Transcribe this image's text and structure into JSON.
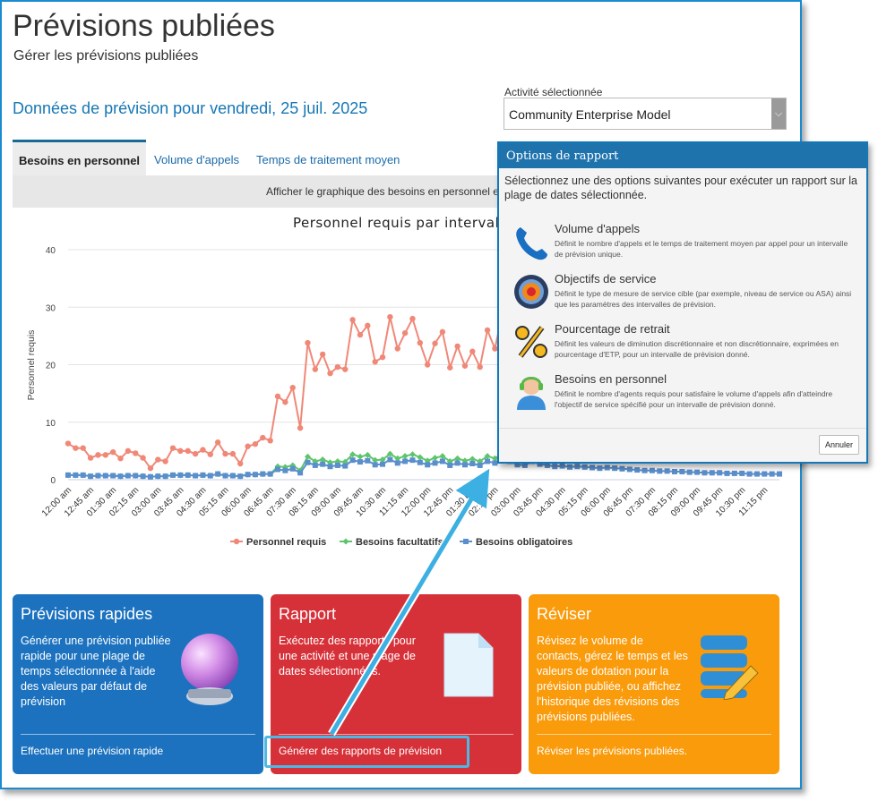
{
  "page": {
    "title": "Prévisions publiées",
    "subtitle": "Gérer les prévisions publiées",
    "forecast_heading": "Données de prévision pour vendredi, 25 juil. 2025"
  },
  "activity": {
    "label": "Activité sélectionnée",
    "value": "Community Enterprise Model"
  },
  "tabs": [
    {
      "label": "Besoins en personnel",
      "active": true
    },
    {
      "label": "Volume d'appels",
      "active": false
    },
    {
      "label": "Temps de traitement moyen",
      "active": false
    }
  ],
  "chart_hint": "Afficher le graphique des besoins en personnel en",
  "chart_data": {
    "type": "line",
    "title": "Personnel requis par intervall",
    "ylabel": "Personnel requis",
    "xlabel": "",
    "ylim": [
      0,
      40
    ],
    "yticks": [
      0,
      10,
      20,
      30,
      40
    ],
    "grid": true,
    "legend_position": "bottom-center",
    "xtick_labels": [
      "12:00 am",
      "12:45 am",
      "01:30 am",
      "02:15 am",
      "03:00 am",
      "03:45 am",
      "04:30 am",
      "05:15 am",
      "06:00 am",
      "06:45 am",
      "07:30 am",
      "08:15 am",
      "09:00 am",
      "09:45 am",
      "10:30 am",
      "11:15 am",
      "12:00 pm",
      "12:45 pm",
      "01:30 pm",
      "02:15 pm",
      "03:00 pm",
      "03:45 pm",
      "04:30 pm",
      "05:15 pm",
      "06:00 pm",
      "06:45 pm",
      "07:30 pm",
      "08:15 pm",
      "09:00 pm",
      "09:45 pm",
      "10:30 pm",
      "11:15 pm"
    ],
    "series": [
      {
        "name": "Personnel requis",
        "color": "#f08878",
        "values": [
          6.3,
          5.5,
          5.5,
          3.8,
          4.3,
          4.3,
          4.8,
          3.7,
          5.0,
          4.6,
          3.8,
          2.0,
          3.5,
          3.2,
          5.5,
          5.0,
          5.0,
          4.5,
          5.2,
          4.4,
          6.5,
          4.5,
          4.5,
          2.8,
          5.8,
          6.2,
          7.3,
          6.8,
          14.5,
          13.5,
          16.0,
          9.0,
          23.8,
          19.2,
          21.8,
          18.5,
          19.6,
          19.2,
          27.8,
          25.2,
          26.8,
          20.5,
          21.3,
          28.3,
          22.8,
          25.5,
          28.0,
          23.8,
          20.0,
          23.7,
          25.7,
          19.5,
          23.2,
          19.8,
          22.3,
          19.6,
          26.0,
          22.8,
          28.8,
          25.5,
          20.5,
          20.2,
          26.5
        ]
      },
      {
        "name": "Besoins facultatifs",
        "color": "#5ec46e",
        "values": [
          0.8,
          0.8,
          0.8,
          0.6,
          0.7,
          0.7,
          0.7,
          0.6,
          0.7,
          0.7,
          0.6,
          0.5,
          0.6,
          0.6,
          0.8,
          0.8,
          0.8,
          0.7,
          0.8,
          0.7,
          1.0,
          0.7,
          0.7,
          0.6,
          0.9,
          0.9,
          1.0,
          1.0,
          2.3,
          2.2,
          2.5,
          1.6,
          4.0,
          3.2,
          3.5,
          3.0,
          3.2,
          3.1,
          4.4,
          4.0,
          4.3,
          3.4,
          3.5,
          4.5,
          3.7,
          4.1,
          4.4,
          3.9,
          3.3,
          3.8,
          4.1,
          3.2,
          3.7,
          3.3,
          3.6,
          3.2,
          4.1,
          3.7,
          4.5,
          4.1,
          3.3,
          3.2,
          4.2
        ]
      },
      {
        "name": "Besoins obligatoires",
        "color": "#5a8fcc",
        "values": [
          0.8,
          0.8,
          0.8,
          0.6,
          0.7,
          0.7,
          0.7,
          0.6,
          0.7,
          0.7,
          0.6,
          0.5,
          0.6,
          0.6,
          0.8,
          0.8,
          0.8,
          0.7,
          0.8,
          0.7,
          1.0,
          0.7,
          0.7,
          0.6,
          0.9,
          0.9,
          1.0,
          1.0,
          1.8,
          1.6,
          1.9,
          1.2,
          3.0,
          2.5,
          2.7,
          2.3,
          2.5,
          2.4,
          3.4,
          3.1,
          3.3,
          2.6,
          2.7,
          3.5,
          2.9,
          3.2,
          3.4,
          3.0,
          2.6,
          2.9,
          3.2,
          2.5,
          2.9,
          2.6,
          2.8,
          2.5,
          3.2,
          2.9,
          3.5,
          3.2,
          2.6,
          2.5,
          3.2,
          2.7,
          2.5,
          2.3,
          2.4,
          2.2,
          2.3,
          2.2,
          2.1,
          2.0,
          2.1,
          2.0,
          1.9,
          1.8,
          1.7,
          1.6,
          1.6,
          1.5,
          1.5,
          1.4,
          1.4,
          1.3,
          1.3,
          1.2,
          1.2,
          1.2,
          1.1,
          1.1,
          1.1,
          1.0,
          1.0,
          1.0,
          1.0,
          1.0
        ]
      }
    ]
  },
  "cards": [
    {
      "title": "Prévisions rapides",
      "desc": "Générer une prévision publiée rapide pour une plage de temps sélectionnée à l'aide des valeurs par défaut de prévision",
      "link": "Effectuer une prévision rapide",
      "color": "#1c72bf"
    },
    {
      "title": "Rapport",
      "desc": "Exécutez des rapports pour une activité et une plage de dates sélectionnées.",
      "link": "Générer des rapports de prévision",
      "color": "#d63139"
    },
    {
      "title": "Réviser",
      "desc": "Révisez le volume de contacts, gérez le temps et les valeurs de dotation pour la prévision publiée, ou affichez l'historique des révisions des prévisions publiées.",
      "link": "Réviser les prévisions publiées.",
      "color": "#fa9b0b"
    }
  ],
  "dialog": {
    "title": "Options de rapport",
    "intro": "Sélectionnez une des options suivantes pour exécuter un rapport sur la plage de dates sélectionnée.",
    "options": [
      {
        "title": "Volume d'appels",
        "desc": "Définit le nombre d'appels et le temps de traitement moyen par appel pour un intervalle de prévision unique.",
        "icon": "phone-icon"
      },
      {
        "title": "Objectifs de service",
        "desc": "Définit le type de mesure de service cible (par exemple, niveau de service ou ASA) ainsi que les paramètres des intervalles de prévision.",
        "icon": "target-icon"
      },
      {
        "title": "Pourcentage de retrait",
        "desc": "Définit les valeurs de diminution discrétionnaire et non discrétionnaire, exprimées en pourcentage d'ETP, pour un intervalle de prévision donné.",
        "icon": "percent-icon"
      },
      {
        "title": "Besoins en personnel",
        "desc": "Définit le nombre d'agents requis pour satisfaire le volume d'appels afin d'atteindre l'objectif de service spécifié pour un intervalle de prévision donné.",
        "icon": "headset-agent-icon"
      }
    ],
    "cancel_label": "Annuler"
  }
}
